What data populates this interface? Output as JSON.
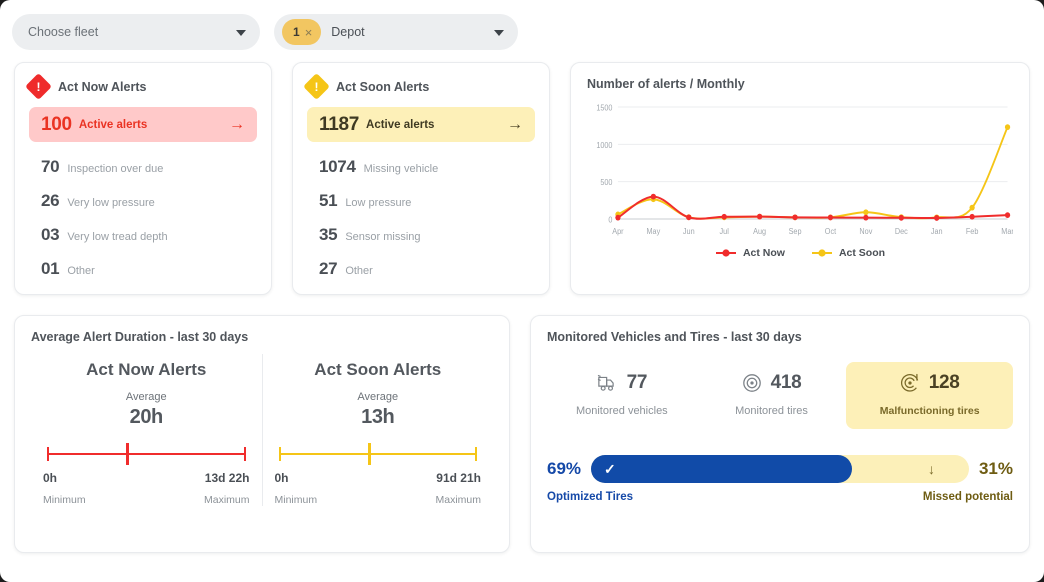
{
  "filters": {
    "fleet_placeholder": "Choose fleet",
    "depot_label": "Depot",
    "depot_count": "1",
    "depot_clear": "×"
  },
  "act_now": {
    "title": "Act Now Alerts",
    "icon": "alert-diamond-icon",
    "color": "#ef2b2b",
    "active_value": "100",
    "active_label": "Active alerts",
    "arrow": "→",
    "rows": [
      {
        "value": "70",
        "label": "Inspection over due"
      },
      {
        "value": "26",
        "label": "Very low pressure"
      },
      {
        "value": "03",
        "label": "Very low tread depth"
      },
      {
        "value": "01",
        "label": "Other"
      }
    ]
  },
  "act_soon": {
    "title": "Act Soon Alerts",
    "icon": "alert-diamond-icon",
    "color": "#f5c517",
    "active_value": "1187",
    "active_label": "Active alerts",
    "arrow": "→",
    "rows": [
      {
        "value": "1074",
        "label": "Missing vehicle"
      },
      {
        "value": "51",
        "label": "Low pressure"
      },
      {
        "value": "35",
        "label": "Sensor missing"
      },
      {
        "value": "27",
        "label": "Other"
      }
    ]
  },
  "chart_card": {
    "title": "Number of alerts / Monthly"
  },
  "chart_data": {
    "type": "line",
    "title": "Number of alerts / Monthly",
    "xlabel": "",
    "ylabel": "",
    "categories": [
      "Apr",
      "May",
      "Jun",
      "Jul",
      "Aug",
      "Sep",
      "Oct",
      "Nov",
      "Dec",
      "Jan",
      "Feb",
      "Mar"
    ],
    "yticks": [
      0,
      500,
      1000,
      1500
    ],
    "ylim": [
      0,
      1500
    ],
    "grid": true,
    "legend_position": "bottom",
    "series": [
      {
        "name": "Act Now",
        "color": "#f02c2c",
        "values": [
          18,
          300,
          22,
          30,
          32,
          22,
          20,
          18,
          16,
          14,
          30,
          52
        ]
      },
      {
        "name": "Act Soon",
        "color": "#f5c517",
        "values": [
          62,
          265,
          24,
          22,
          32,
          22,
          22,
          90,
          24,
          22,
          152,
          1230
        ]
      }
    ]
  },
  "duration_card": {
    "title": "Average Alert Duration - last 30 days",
    "columns": [
      {
        "title": "Act Now Alerts",
        "average_label": "Average",
        "average_value": "20h",
        "min_value": "0h",
        "max_value": "13d 22h",
        "min_caption": "Minimum",
        "max_caption": "Maximum",
        "color": "#f02c2c",
        "marker_percent": 42
      },
      {
        "title": "Act Soon Alerts",
        "average_label": "Average",
        "average_value": "13h",
        "min_value": "0h",
        "max_value": "91d 21h",
        "min_caption": "Minimum",
        "max_caption": "Maximum",
        "color": "#f5c517",
        "marker_percent": 47
      }
    ]
  },
  "monitored_card": {
    "title": "Monitored Vehicles and Tires - last 30 days",
    "stats": [
      {
        "icon": "truck-icon",
        "value": "77",
        "caption": "Monitored vehicles",
        "highlight": false
      },
      {
        "icon": "tire-icon",
        "value": "418",
        "caption": "Monitored tires",
        "highlight": false
      },
      {
        "icon": "malfunctioning-tire-icon",
        "value": "128",
        "caption": "Malfunctioning tires",
        "highlight": true
      }
    ],
    "progress": {
      "left_percent": "69%",
      "right_percent": "31%",
      "fill_percent": 69,
      "left_caption": "Optimized Tires",
      "right_caption": "Missed potential",
      "check_icon": "✓",
      "down_icon": "↓",
      "fill_color": "#114ba8",
      "track_color": "#fcf0b9"
    }
  }
}
